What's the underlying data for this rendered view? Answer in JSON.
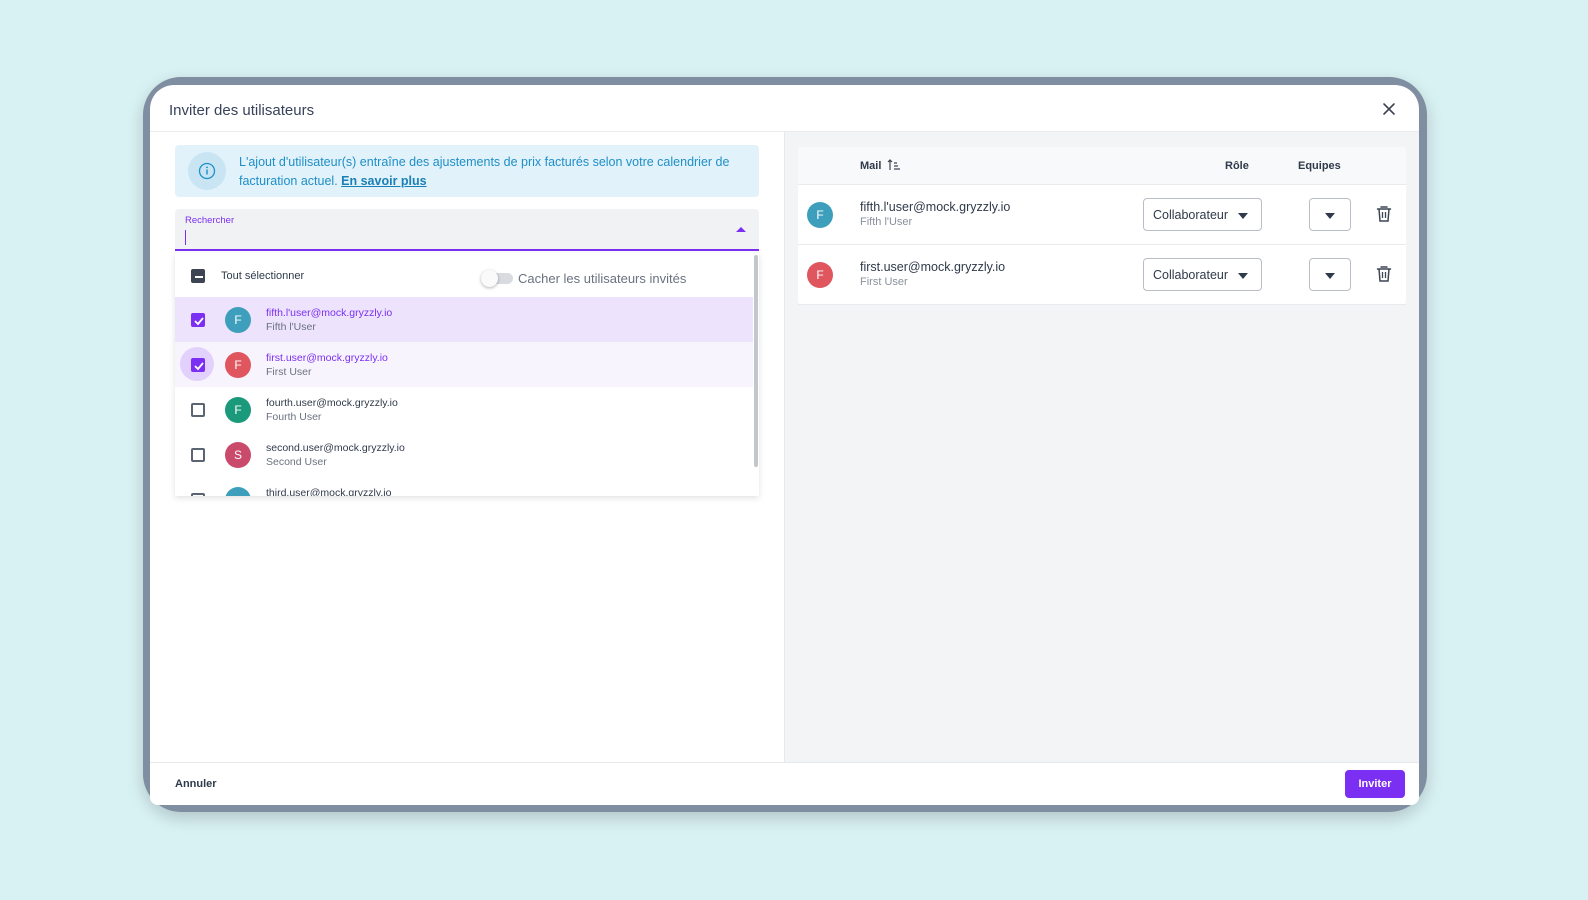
{
  "dialog": {
    "title": "Inviter des utilisateurs",
    "close_icon": "close-icon"
  },
  "info": {
    "icon": "info-icon",
    "text": "L'ajout d'utilisateur(s) entraîne des ajustements de prix facturés selon votre calendrier de facturation actuel.",
    "link_label": "En savoir plus"
  },
  "search": {
    "label": "Rechercher",
    "value": "",
    "toggle_icon": "chevron-up-icon"
  },
  "list": {
    "select_all_label": "Tout sélectionner",
    "select_all_state": "indeterminate",
    "hide_invited_label": "Cacher les utilisateurs invités",
    "hide_invited_on": false,
    "users": [
      {
        "email": "fifth.l'user@mock.gryzzly.io",
        "name": "Fifth l'User",
        "initial": "F",
        "color": "#3e9fbd",
        "checked": true
      },
      {
        "email": "first.user@mock.gryzzly.io",
        "name": "First User",
        "initial": "F",
        "color": "#e0565f",
        "checked": true
      },
      {
        "email": "fourth.user@mock.gryzzly.io",
        "name": "Fourth User",
        "initial": "F",
        "color": "#1a9a7b",
        "checked": false
      },
      {
        "email": "second.user@mock.gryzzly.io",
        "name": "Second User",
        "initial": "S",
        "color": "#c94a6a",
        "checked": false
      },
      {
        "email": "third.user@mock.gryzzly.io",
        "name": "",
        "initial": "",
        "color": "#3e9fbd",
        "checked": false
      }
    ]
  },
  "table": {
    "col_mail": "Mail",
    "col_role": "Rôle",
    "col_teams": "Equipes",
    "sort_icon": "sort-ascending-icon",
    "rows": [
      {
        "email": "fifth.l'user@mock.gryzzly.io",
        "name": "Fifth l'User",
        "initial": "F",
        "color": "#3e9fbd",
        "role": "Collaborateur"
      },
      {
        "email": "first.user@mock.gryzzly.io",
        "name": "First User",
        "initial": "F",
        "color": "#e0565f",
        "role": "Collaborateur"
      }
    ]
  },
  "footer": {
    "cancel_label": "Annuler",
    "invite_label": "Inviter"
  },
  "colors": {
    "accent": "#7b2ff2",
    "backdrop": "#d8f1f3",
    "info_bg": "#e1f2fb",
    "info_text": "#1f8fc7"
  }
}
